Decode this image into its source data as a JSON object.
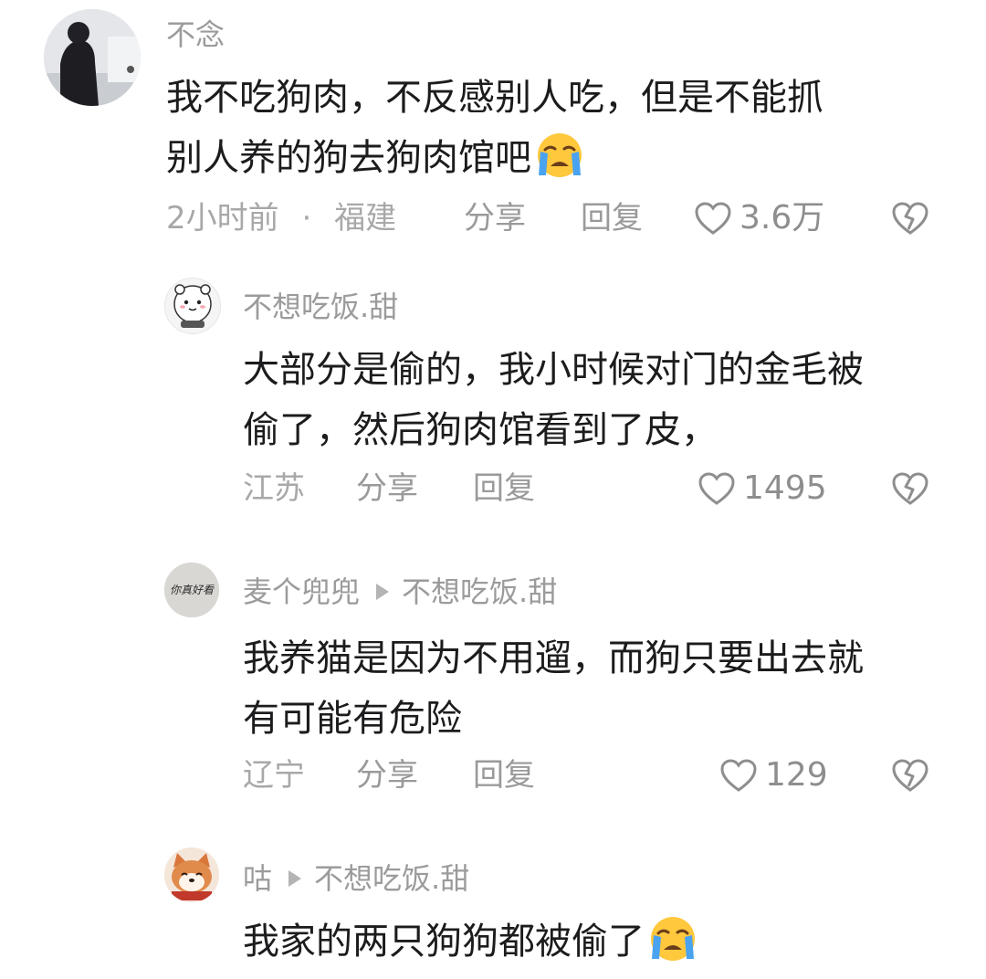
{
  "comments": [
    {
      "user": "不念",
      "lines": [
        "我不吃狗肉，不反感别人吃，但是不能抓",
        "别人养的狗去狗肉馆吧"
      ],
      "emoji": "crying-face",
      "time": "2小时前",
      "dot": "·",
      "location": "福建",
      "share": "分享",
      "reply": "回复",
      "likes": "3.6万"
    },
    {
      "user": "不想吃饭.甜",
      "lines": [
        "大部分是偷的，我小时候对门的金毛被",
        "偷了，然后狗肉馆看到了皮，"
      ],
      "location": "江苏",
      "share": "分享",
      "reply": "回复",
      "likes": "1495"
    },
    {
      "user": "麦个兜兜",
      "reply_to": "不想吃饭.甜",
      "avatar_text": "你真好看",
      "lines": [
        "我养猫是因为不用遛，而狗只要出去就",
        "有可能有危险"
      ],
      "location": "辽宁",
      "share": "分享",
      "reply": "回复",
      "likes": "129"
    },
    {
      "user": "咕",
      "reply_to": "不想吃饭.甜",
      "lines": [
        "我家的两只狗狗都被偷了"
      ],
      "emoji": "crying-face"
    }
  ],
  "colors": {
    "text": "#1c1c1e",
    "secondary": "#9b9b9b",
    "emoji": "#ffc83d",
    "tears": "#4aa3f0"
  }
}
